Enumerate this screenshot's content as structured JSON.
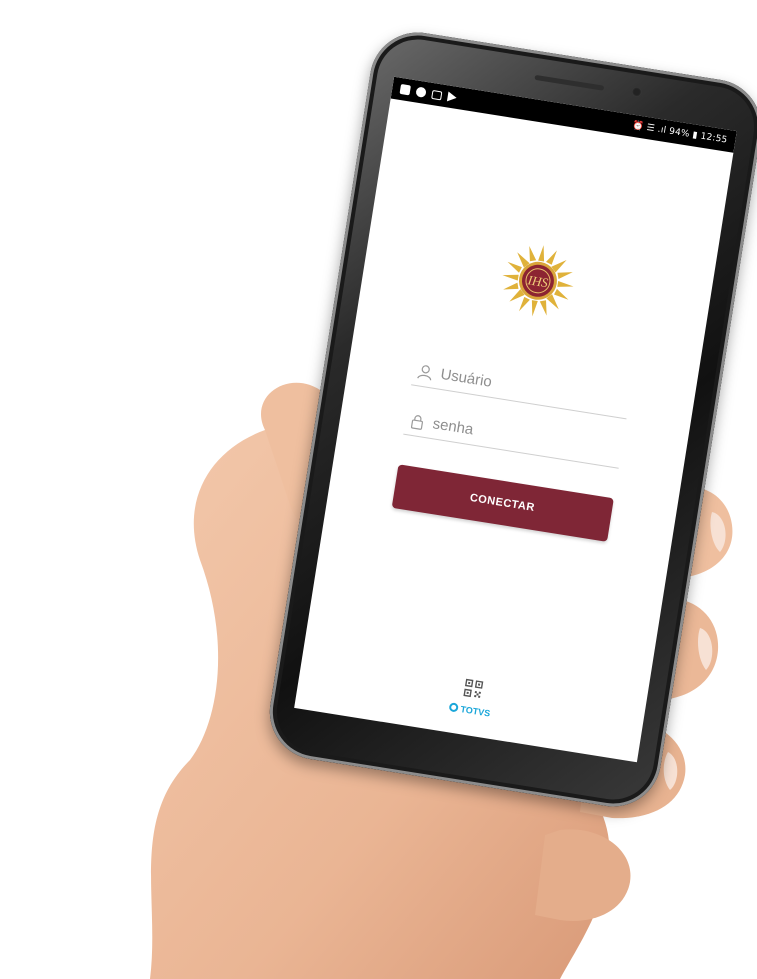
{
  "status_bar": {
    "left_icons": [
      "gallery-icon",
      "globe-icon",
      "mail-icon",
      "flag-icon"
    ],
    "right_text": "⏰ ☰ .ıl 94% ▮ 12:55"
  },
  "login": {
    "logo": "ihs-emblem",
    "username_placeholder": "Usuário",
    "password_placeholder": "senha",
    "connect_label": "CONECTAR"
  },
  "footer": {
    "qr_icon": "qr-code-icon",
    "brand_label": "TOTVS"
  },
  "colors": {
    "button": "#7f2636",
    "brand": "#1aa6d9",
    "status_bar": "#000000"
  }
}
